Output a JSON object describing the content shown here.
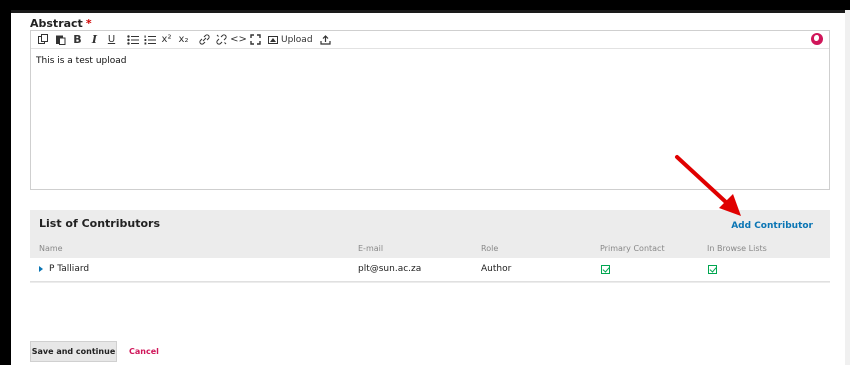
{
  "abstract": {
    "label": "Abstract",
    "required_mark": "*",
    "content": "This is a test upload"
  },
  "toolbar": {
    "buttons": [
      "copy-icon",
      "paste-icon",
      "bold",
      "italic",
      "underline",
      "bullet-list-icon",
      "numbered-list-icon",
      "superscript",
      "subscript",
      "link-icon",
      "unlink-icon",
      "code-icon",
      "fullscreen-icon"
    ],
    "bold_label": "B",
    "italic_label": "I",
    "underline_label": "U",
    "superscript_label": "x²",
    "subscript_label": "x₂",
    "code_label": "<>",
    "upload_label": "Upload"
  },
  "contributors": {
    "title": "List of Contributors",
    "add_label": "Add Contributor",
    "columns": [
      "Name",
      "E-mail",
      "Role",
      "Primary Contact",
      "In Browse Lists"
    ],
    "rows": [
      {
        "name": "P Talliard",
        "email": "plt@sun.ac.za",
        "role": "Author",
        "primary_contact": true,
        "in_browse_lists": true
      }
    ]
  },
  "actions": {
    "save_label": "Save and continue",
    "cancel_label": "Cancel"
  },
  "colors": {
    "accent": "#0a75b4",
    "cancel": "#d0165a",
    "required": "#d00000",
    "check": "#00a650",
    "annotation_arrow": "#e00000"
  }
}
